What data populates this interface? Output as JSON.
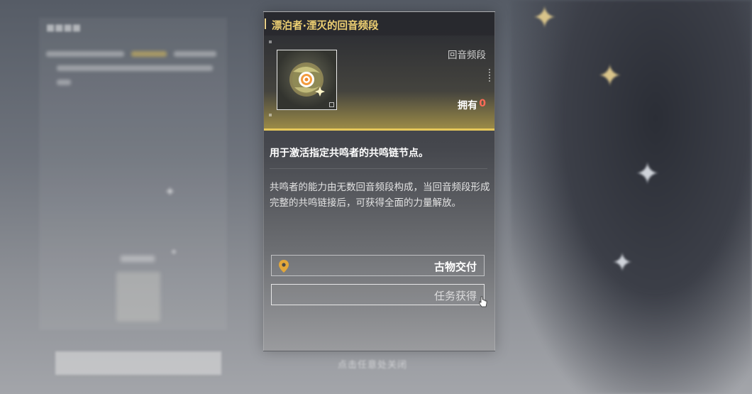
{
  "dialog": {
    "title": "漂泊者·湮灭的回音频段",
    "item": {
      "type": "回音频段",
      "owned_label": "拥有",
      "owned_count": "0",
      "icon": "resonance-chain-icon"
    },
    "description": "用于激活指定共鸣者的共鸣链节点。",
    "lore": "共鸣者的能力由无数回音频段构成，当回音频段形成完整的共鸣链接后，可获得全面的力量解放。",
    "sources": [
      {
        "label": "古物交付",
        "icon": "map-pin-icon"
      },
      {
        "label": "任务获得",
        "icon": ""
      }
    ]
  },
  "close_hint": "点击任意处关闭",
  "colors": {
    "title": "#efd173",
    "accent_gold": "#e6c85a",
    "owned_count": "#ff6b57"
  }
}
